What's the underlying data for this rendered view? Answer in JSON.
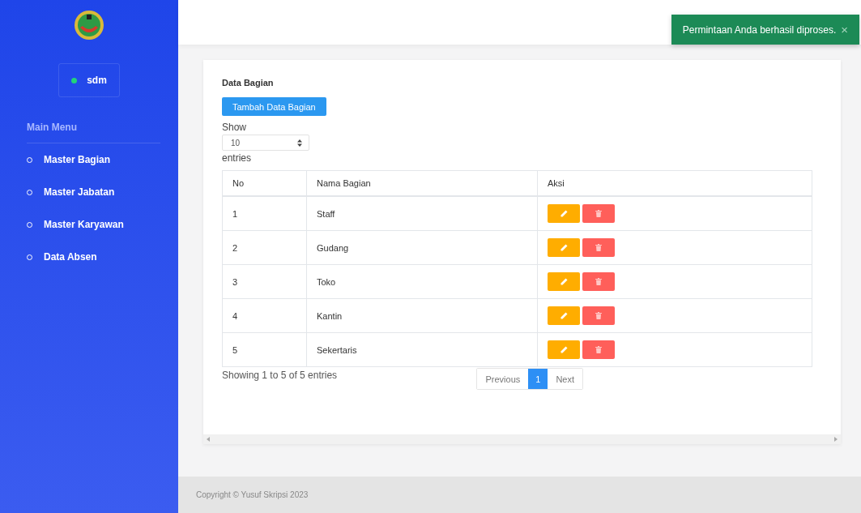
{
  "sidebar": {
    "user": {
      "name": "sdm",
      "online": true
    },
    "section_title": "Main Menu",
    "items": [
      {
        "label": "Master Bagian"
      },
      {
        "label": "Master Jabatan"
      },
      {
        "label": "Master Karyawan"
      },
      {
        "label": "Data Absen"
      }
    ]
  },
  "toast": {
    "message": "Permintaan Anda berhasil diproses.",
    "close": "×"
  },
  "card": {
    "title": "Data Bagian",
    "add_button": "Tambah Data Bagian",
    "length": {
      "before": "Show",
      "value": "10",
      "after": "entries"
    },
    "table": {
      "columns": [
        "No",
        "Nama Bagian",
        "Aksi"
      ],
      "rows": [
        {
          "no": "1",
          "name": "Staff"
        },
        {
          "no": "2",
          "name": "Gudang"
        },
        {
          "no": "3",
          "name": "Toko"
        },
        {
          "no": "4",
          "name": "Kantin"
        },
        {
          "no": "5",
          "name": "Sekertaris"
        }
      ]
    },
    "info": "Showing 1 to 5 of 5 entries",
    "pagination": [
      {
        "label": "Previous",
        "selected": false
      },
      {
        "label": "1",
        "selected": true
      },
      {
        "label": "Next",
        "selected": false
      }
    ]
  },
  "footer": "Copyright © Yusuf Skripsi 2023"
}
